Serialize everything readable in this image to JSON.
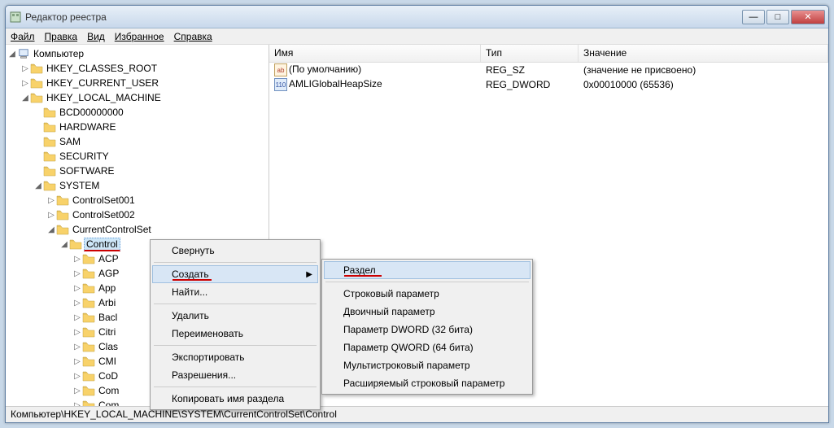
{
  "title": "Редактор реестра",
  "menubar": [
    "Файл",
    "Правка",
    "Вид",
    "Избранное",
    "Справка"
  ],
  "tree": {
    "root": "Компьютер",
    "hkeys": [
      "HKEY_CLASSES_ROOT",
      "HKEY_CURRENT_USER",
      "HKEY_LOCAL_MACHINE"
    ],
    "hklm": [
      "BCD00000000",
      "HARDWARE",
      "SAM",
      "SECURITY",
      "SOFTWARE",
      "SYSTEM"
    ],
    "system": [
      "ControlSet001",
      "ControlSet002",
      "CurrentControlSet"
    ],
    "ccs_selected": "Control",
    "control_children": [
      "ACP",
      "AGP",
      "App",
      "Arbi",
      "Bacl",
      "Citri",
      "Clas",
      "CMI",
      "CoD",
      "Com",
      "Com"
    ]
  },
  "list": {
    "headers": {
      "name": "Имя",
      "type": "Тип",
      "value": "Значение"
    },
    "rows": [
      {
        "icon": "str",
        "name": "(По умолчанию)",
        "type": "REG_SZ",
        "value": "(значение не присвоено)"
      },
      {
        "icon": "bin",
        "name": "AMLIGlobalHeapSize",
        "type": "REG_DWORD",
        "value": "0x00010000 (65536)"
      }
    ]
  },
  "context_menu_1": {
    "collapse": "Свернуть",
    "create": "Создать",
    "find": "Найти...",
    "delete": "Удалить",
    "rename": "Переименовать",
    "export": "Экспортировать",
    "permissions": "Разрешения...",
    "copy_key": "Копировать имя раздела"
  },
  "context_menu_2": {
    "key": "Раздел",
    "string": "Строковый параметр",
    "binary": "Двоичный параметр",
    "dword": "Параметр DWORD (32 бита)",
    "qword": "Параметр QWORD (64 бита)",
    "multi": "Мультистроковый параметр",
    "expand": "Расширяемый строковый параметр"
  },
  "statusbar": "Компьютер\\HKEY_LOCAL_MACHINE\\SYSTEM\\CurrentControlSet\\Control"
}
